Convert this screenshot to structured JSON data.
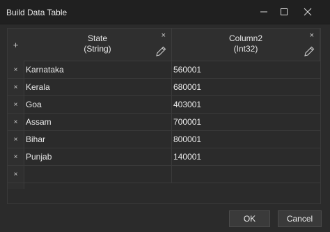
{
  "window": {
    "title": "Build Data Table"
  },
  "table": {
    "add_column_glyph": "+",
    "remove_glyph": "×",
    "columns": [
      {
        "name": "State",
        "type": "(String)"
      },
      {
        "name": "Column2",
        "type": "(Int32)"
      }
    ],
    "rows": [
      [
        "Karnataka",
        "560001"
      ],
      [
        "Kerala",
        "680001"
      ],
      [
        "Goa",
        "403001"
      ],
      [
        "Assam",
        "700001"
      ],
      [
        "Bihar",
        "800001"
      ],
      [
        "Punjab",
        "140001"
      ],
      [
        "",
        ""
      ]
    ]
  },
  "buttons": {
    "ok": "OK",
    "cancel": "Cancel"
  }
}
